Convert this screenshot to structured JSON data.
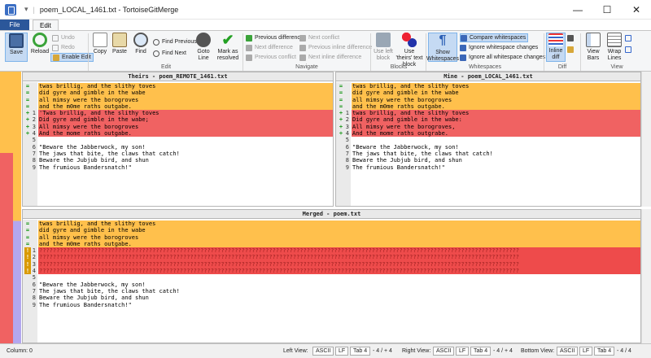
{
  "window": {
    "title": "poem_LOCAL_1461.txt - TortoiseGitMerge",
    "min": "—",
    "max": "☐",
    "close": "✕"
  },
  "tabs": {
    "file": "File",
    "edit": "Edit"
  },
  "ribbon": {
    "save": "Save",
    "reload": "Reload",
    "undo": "Undo",
    "redo": "Redo",
    "enable_edit": "Enable Edit",
    "copy": "Copy",
    "paste": "Paste",
    "find": "Find",
    "find_previous": "Find Previous",
    "find_next": "Find Next",
    "goto_line": "Goto Line",
    "mark_resolved": "Mark as resolved",
    "prev_difference": "Previous difference",
    "next_difference": "Next difference",
    "prev_conflict": "Previous conflict",
    "next_conflict": "Next conflict",
    "prev_inline": "Previous inline difference",
    "next_inline": "Next inline difference",
    "use_left_block": "Use left block",
    "use_theirs_block": "Use 'theirs' text block",
    "show_whitespaces": "Show Whitespaces",
    "compare_whitespaces": "Compare whitespaces",
    "ignore_ws_changes": "Ignore whitespace changes",
    "ignore_all_ws": "Ignore all whitespace changes",
    "inline_diff": "Inline diff",
    "view_bars": "View Bars",
    "wrap_lines": "Wrap Lines",
    "groups": {
      "edit": "Edit",
      "navigate": "Navigate",
      "blocks": "Blocks",
      "whitespaces": "Whitespaces",
      "diff": "Diff",
      "view": "View"
    }
  },
  "theirs_pane": {
    "header": "Theirs - poem_REMOTE_1461.txt",
    "lines": [
      {
        "m": "=",
        "n": "",
        "t": "twas brillig, and the slithy toves"
      },
      {
        "m": "=",
        "n": "",
        "t": "did gyre and gimble in the wabe"
      },
      {
        "m": "=",
        "n": "",
        "t": "all mimsy were the borogroves"
      },
      {
        "m": "=",
        "n": "",
        "t": "and the m0me raths outgabe."
      },
      {
        "m": "+",
        "n": "1",
        "t": "'Twas brillig, and the slithy toves"
      },
      {
        "m": "+",
        "n": "2",
        "t": "Did gyre and gimble in the wabe;"
      },
      {
        "m": "+",
        "n": "3",
        "t": "All mimsy were the borogroves"
      },
      {
        "m": "+",
        "n": "4",
        "t": "And the mome raths outgabe."
      },
      {
        "m": "",
        "n": "5",
        "t": ""
      },
      {
        "m": "",
        "n": "6",
        "t": "\"Beware the Jabberwock, my son!"
      },
      {
        "m": "",
        "n": "7",
        "t": "The jaws that bite, the claws that catch!"
      },
      {
        "m": "",
        "n": "8",
        "t": "Beware the Jubjub bird, and shun"
      },
      {
        "m": "",
        "n": "9",
        "t": "The frumious Bandersnatch!\""
      }
    ]
  },
  "mine_pane": {
    "header": "Mine - poem_LOCAL_1461.txt",
    "lines": [
      {
        "m": "=",
        "n": "",
        "t": "twas brillig, and the slithy toves"
      },
      {
        "m": "=",
        "n": "",
        "t": "did gyre and gimble in the wabe"
      },
      {
        "m": "=",
        "n": "",
        "t": "all mimsy were the borogroves"
      },
      {
        "m": "=",
        "n": "",
        "t": "and the m0me raths outgabe."
      },
      {
        "m": "+",
        "n": "1",
        "t": "twas brillig, and the slithy toves"
      },
      {
        "m": "+",
        "n": "2",
        "t": "Did gyre and gimble in the wabe:"
      },
      {
        "m": "+",
        "n": "3",
        "t": "All mimsy were the borogroves,"
      },
      {
        "m": "+",
        "n": "4",
        "t": "And the mome raths outgrabe."
      },
      {
        "m": "",
        "n": "5",
        "t": ""
      },
      {
        "m": "",
        "n": "6",
        "t": "\"Beware the Jabberwock, my son!"
      },
      {
        "m": "",
        "n": "7",
        "t": "The jaws that bite, the claws that catch!"
      },
      {
        "m": "",
        "n": "8",
        "t": "Beware the Jubjub bird, and shun"
      },
      {
        "m": "",
        "n": "9",
        "t": "The frumious Bandersnatch!\""
      }
    ]
  },
  "merged_pane": {
    "header": "Merged - poem.txt",
    "lines": [
      {
        "m": "=",
        "n": "",
        "t": "twas brillig, and the slithy toves"
      },
      {
        "m": "=",
        "n": "",
        "t": "did gyre and gimble in the wabe"
      },
      {
        "m": "=",
        "n": "",
        "t": "all mimsy were the borogroves"
      },
      {
        "m": "=",
        "n": "",
        "t": "and the m0me raths outgabe."
      },
      {
        "m": "!",
        "n": "1",
        "t": "????????????????????????????????????????????????????????????????????????????????????????????????????????????????????????????????????????????"
      },
      {
        "m": "!",
        "n": "2",
        "t": "????????????????????????????????????????????????????????????????????????????????????????????????????????????????????????????????????????????"
      },
      {
        "m": "!",
        "n": "3",
        "t": "????????????????????????????????????????????????????????????????????????????????????????????????????????????????????????????????????????????"
      },
      {
        "m": "!",
        "n": "4",
        "t": "????????????????????????????????????????????????????????????????????????????????????????????????????????????????????????????????????????????"
      },
      {
        "m": "",
        "n": "5",
        "t": ""
      },
      {
        "m": "",
        "n": "6",
        "t": "\"Beware the Jabberwock, my son!"
      },
      {
        "m": "",
        "n": "7",
        "t": "The jaws that bite, the claws that catch!"
      },
      {
        "m": "",
        "n": "8",
        "t": "Beware the Jubjub bird, and shun"
      },
      {
        "m": "",
        "n": "9",
        "t": "The frumious Bandersnatch!\""
      }
    ]
  },
  "status": {
    "column": "Column: 0",
    "left_view": "Left View:",
    "right_view": "Right View:",
    "bottom_view": "Bottom View:",
    "encoding": "ASCII",
    "eol": "LF",
    "tab": "Tab 4",
    "left_count": "- 4 / + 4",
    "right_count": "- 4 / + 4",
    "bottom_count": "- 4 / 4"
  },
  "colors": {
    "equal": "#ffc04c",
    "changed": "#f06262",
    "conflict": "#ee4b4b",
    "file_tab": "#2b579a"
  }
}
